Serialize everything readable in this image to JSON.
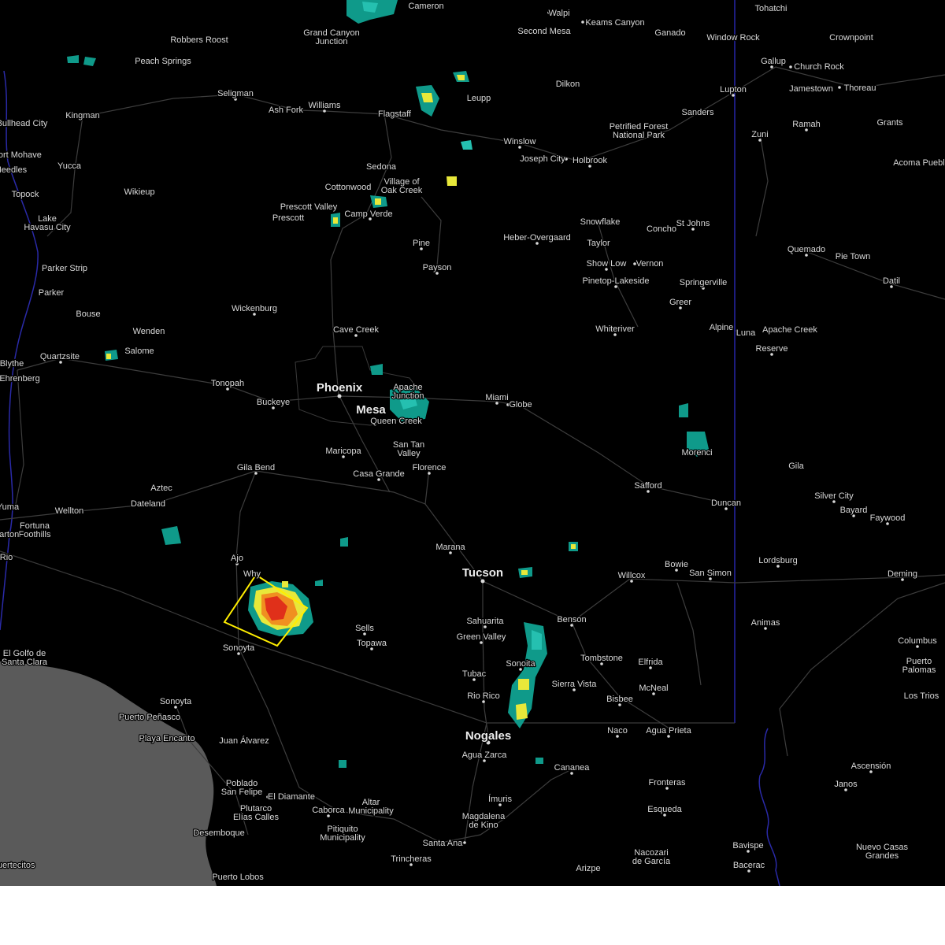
{
  "map": {
    "background": "#000000",
    "sea_color": "#5a5a5a",
    "road_color": "#3d3d3d",
    "border_color": "#2f2fd0",
    "warning_box_color": "#ffee00",
    "radar_colors": [
      "#0f9a8a",
      "#25c0b0",
      "#e8e83a",
      "#f09020",
      "#e0301a"
    ],
    "places": [
      {
        "name": "Cameron"
      },
      {
        "name": "Tohatchi"
      },
      {
        "name": "Walpi"
      },
      {
        "name": "Keams Canyon"
      },
      {
        "name": "Second Mesa"
      },
      {
        "name": "Ganado"
      },
      {
        "name": "Window Rock"
      },
      {
        "name": "Crownpoint"
      },
      {
        "name": "Robbers Roost"
      },
      {
        "name": "Grand Canyon"
      },
      {
        "name": "Junction"
      },
      {
        "name": "Peach Springs"
      },
      {
        "name": "Dilkon"
      },
      {
        "name": "Gallup"
      },
      {
        "name": "Church Rock"
      },
      {
        "name": "Lupton"
      },
      {
        "name": "Jamestown"
      },
      {
        "name": "Thoreau"
      },
      {
        "name": "Seligman"
      },
      {
        "name": "Leupp"
      },
      {
        "name": "Bullhead City"
      },
      {
        "name": "Kingman"
      },
      {
        "name": "Ash Fork"
      },
      {
        "name": "Williams"
      },
      {
        "name": "Flagstaff"
      },
      {
        "name": "Sanders"
      },
      {
        "name": "Grants"
      },
      {
        "name": "Ramah"
      },
      {
        "name": "Petrified Forest"
      },
      {
        "name": "National Park"
      },
      {
        "name": "Zuni"
      },
      {
        "name": "Fort Mohave"
      },
      {
        "name": "Winslow"
      },
      {
        "name": "Joseph City"
      },
      {
        "name": "Holbrook"
      },
      {
        "name": "Needles"
      },
      {
        "name": "Yucca"
      },
      {
        "name": "Acoma Pueblo"
      },
      {
        "name": "Sedona"
      },
      {
        "name": "Village of"
      },
      {
        "name": "Oak Creek"
      },
      {
        "name": "Cottonwood"
      },
      {
        "name": "Topock"
      },
      {
        "name": "Wikieup"
      },
      {
        "name": "Prescott Valley"
      },
      {
        "name": "Prescott"
      },
      {
        "name": "Camp Verde"
      },
      {
        "name": "Snowflake"
      },
      {
        "name": "Lake"
      },
      {
        "name": "Havasu City"
      },
      {
        "name": "Concho"
      },
      {
        "name": "St Johns"
      },
      {
        "name": "Taylor"
      },
      {
        "name": "Heber-Overgaard"
      },
      {
        "name": "Pine"
      },
      {
        "name": "Quemado"
      },
      {
        "name": "Pie Town"
      },
      {
        "name": "Show Low"
      },
      {
        "name": "Vernon"
      },
      {
        "name": "Parker Strip"
      },
      {
        "name": "Payson"
      },
      {
        "name": "Pinetop-Lakeside"
      },
      {
        "name": "Springerville"
      },
      {
        "name": "Datil"
      },
      {
        "name": "Parker"
      },
      {
        "name": "Greer"
      },
      {
        "name": "Wickenburg"
      },
      {
        "name": "Bouse"
      },
      {
        "name": "Whiteriver"
      },
      {
        "name": "Alpine"
      },
      {
        "name": "Luna"
      },
      {
        "name": "Apache Creek"
      },
      {
        "name": "Wenden"
      },
      {
        "name": "Cave Creek"
      },
      {
        "name": "Reserve"
      },
      {
        "name": "Salome"
      },
      {
        "name": "Quartzsite"
      },
      {
        "name": "Blythe"
      },
      {
        "name": "Ehrenberg"
      },
      {
        "name": "Tonopah"
      },
      {
        "name": "Phoenix"
      },
      {
        "name": "Apache"
      },
      {
        "name": "Junction"
      },
      {
        "name": "Buckeye"
      },
      {
        "name": "Mesa"
      },
      {
        "name": "Miami"
      },
      {
        "name": "Globe"
      },
      {
        "name": "Queen Creek"
      },
      {
        "name": "San Tan"
      },
      {
        "name": "Valley"
      },
      {
        "name": "Morenci"
      },
      {
        "name": "Maricopa"
      },
      {
        "name": "Gila Bend"
      },
      {
        "name": "Florence"
      },
      {
        "name": "Gila"
      },
      {
        "name": "Casa Grande"
      },
      {
        "name": "Aztec"
      },
      {
        "name": "Safford"
      },
      {
        "name": "Silver City"
      },
      {
        "name": "Dateland"
      },
      {
        "name": "Duncan"
      },
      {
        "name": "Wellton"
      },
      {
        "name": "Bayard"
      },
      {
        "name": "Yuma"
      },
      {
        "name": "Faywood"
      },
      {
        "name": "Fortuna"
      },
      {
        "name": "Foothills"
      },
      {
        "name": "Barton"
      },
      {
        "name": "Marana"
      },
      {
        "name": "Ajo"
      },
      {
        "name": "Lordsburg"
      },
      {
        "name": "Rio"
      },
      {
        "name": "Bowie"
      },
      {
        "name": "San Simon"
      },
      {
        "name": "Why"
      },
      {
        "name": "Tucson"
      },
      {
        "name": "Willcox"
      },
      {
        "name": "Deming"
      },
      {
        "name": "Animas"
      },
      {
        "name": "Benson"
      },
      {
        "name": "Sahuarita"
      },
      {
        "name": "Sells"
      },
      {
        "name": "Green Valley"
      },
      {
        "name": "Topawa"
      },
      {
        "name": "Sonoyta"
      },
      {
        "name": "Columbus"
      },
      {
        "name": "El Golfo de"
      },
      {
        "name": "Santa Clara"
      },
      {
        "name": "Tombstone"
      },
      {
        "name": "Elfrida"
      },
      {
        "name": "Puerto"
      },
      {
        "name": "Palomas"
      },
      {
        "name": "Sonoita"
      },
      {
        "name": "Tubac"
      },
      {
        "name": "Sierra Vista"
      },
      {
        "name": "McNeal"
      },
      {
        "name": "Rio Rico"
      },
      {
        "name": "Bisbee"
      },
      {
        "name": "Los Trios"
      },
      {
        "name": "Sonoyta"
      },
      {
        "name": "Puerto Peñasco"
      },
      {
        "name": "Naco"
      },
      {
        "name": "Agua Prieta"
      },
      {
        "name": "Playa Encanto"
      },
      {
        "name": "Nogales"
      },
      {
        "name": "Juan Álvarez"
      },
      {
        "name": "Agua Zarca"
      },
      {
        "name": "Cananea"
      },
      {
        "name": "Ascensión"
      },
      {
        "name": "Poblado"
      },
      {
        "name": "San Felipe"
      },
      {
        "name": "El Diamante"
      },
      {
        "name": "Fronteras"
      },
      {
        "name": "Janos"
      },
      {
        "name": "Plutarco"
      },
      {
        "name": "Elías Calles"
      },
      {
        "name": "Altar"
      },
      {
        "name": "Municipality"
      },
      {
        "name": "Caborca"
      },
      {
        "name": "Ímuris"
      },
      {
        "name": "Esqueda"
      },
      {
        "name": "Desemboque"
      },
      {
        "name": "Pitiquito"
      },
      {
        "name": "Municipality"
      },
      {
        "name": "Magdalena"
      },
      {
        "name": "de Kino"
      },
      {
        "name": "Bavispe"
      },
      {
        "name": "Nuevo Casas"
      },
      {
        "name": "Grandes"
      },
      {
        "name": "Santa Ana"
      },
      {
        "name": "Trincheras"
      },
      {
        "name": "Nacozari"
      },
      {
        "name": "de García"
      },
      {
        "name": "Puertecitos"
      },
      {
        "name": "Arizpe"
      },
      {
        "name": "Bacerac"
      },
      {
        "name": "Puerto Lobos"
      }
    ]
  }
}
